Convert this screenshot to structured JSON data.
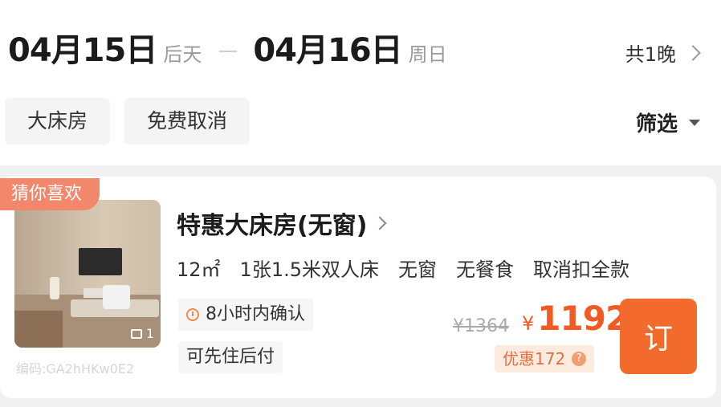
{
  "header": {
    "checkin": {
      "date": "04月15日",
      "day": "后天"
    },
    "checkout": {
      "date": "04月16日",
      "day": "周日"
    },
    "nights": "共1晚"
  },
  "filters": {
    "chips": [
      "大床房",
      "免费取消"
    ],
    "filter_label": "筛选"
  },
  "room": {
    "badge": "猜你喜欢",
    "photo_count": "1",
    "code": "编码:GA2hHKw0E2",
    "title": "特惠大床房(无窗)",
    "facts": [
      "12㎡",
      "1张1.5米双人床",
      "无窗",
      "无餐食",
      "取消扣全款"
    ],
    "tags": [
      "8小时内确认",
      "可先住后付"
    ],
    "original_price": "¥1364",
    "currency": "¥",
    "price": "1192",
    "discount": "优惠172",
    "discount_icon": "?",
    "book_label": "订"
  },
  "colors": {
    "accent": "#f15a22",
    "badge": "#f3876c",
    "book": "#f26b2c"
  }
}
